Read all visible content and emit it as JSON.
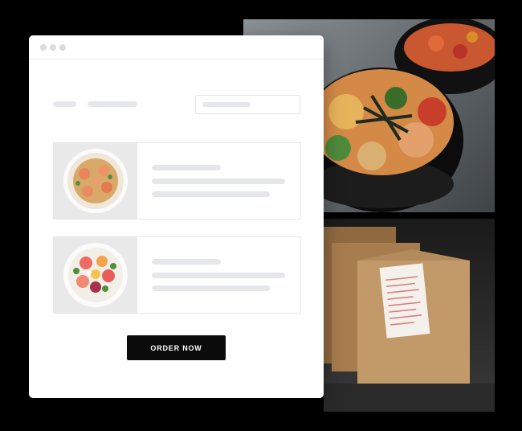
{
  "order_button": {
    "label": "ORDER NOW"
  },
  "colors": {
    "page_background": "#000000",
    "window_background": "#ffffff",
    "placeholder_bar": "#e6e7ea",
    "button_background": "#0b0b0b",
    "button_text": "#ffffff"
  },
  "cards": [
    {
      "image": "shrimp-pasta-bowl"
    },
    {
      "image": "fruit-salad-bowl"
    }
  ],
  "photos": [
    {
      "image": "poke-bowls-on-counter"
    },
    {
      "image": "takeout-paper-bags-with-receipt"
    }
  ]
}
